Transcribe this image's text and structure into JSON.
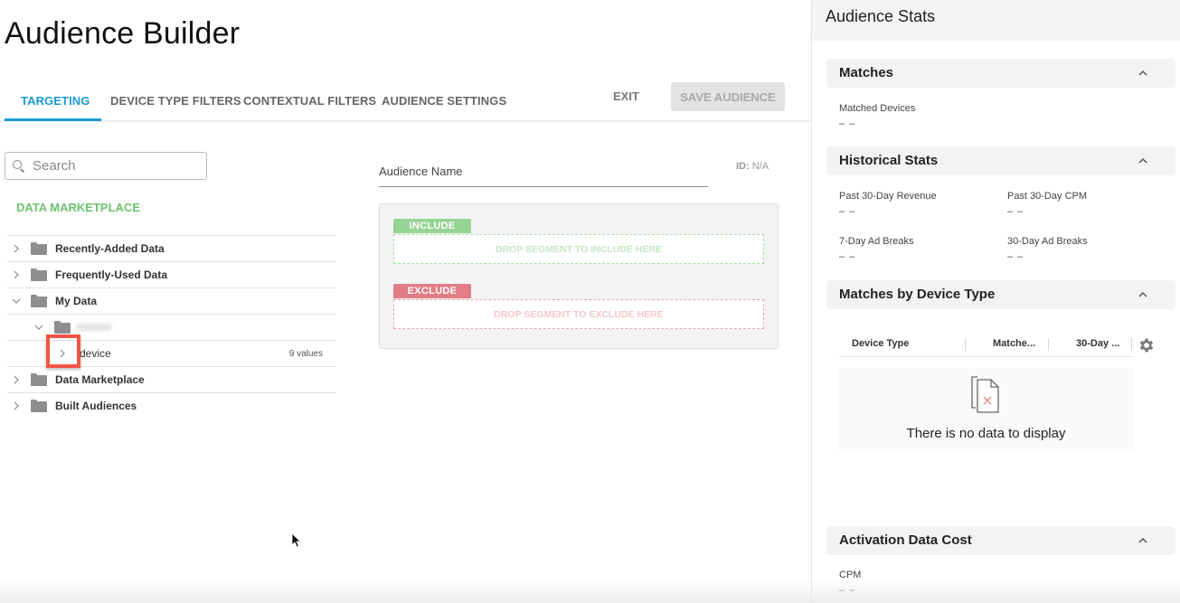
{
  "page": {
    "title": "Audience Builder"
  },
  "tabs": [
    {
      "label": "TARGETING",
      "active": true
    },
    {
      "label": "DEVICE TYPE FILTERS",
      "active": false
    },
    {
      "label": "CONTEXTUAL FILTERS",
      "active": false
    },
    {
      "label": "AUDIENCE SETTINGS",
      "active": false
    }
  ],
  "actions": {
    "exit_label": "EXIT",
    "save_label": "SAVE AUDIENCE"
  },
  "search": {
    "placeholder": "Search",
    "value": ""
  },
  "data_marketplace_heading": "DATA MARKETPLACE",
  "tree": {
    "items": [
      {
        "label": "Recently-Added Data",
        "expanded": false,
        "level": 0
      },
      {
        "label": "Frequently-Used Data",
        "expanded": false,
        "level": 0
      },
      {
        "label": "My Data",
        "expanded": true,
        "level": 0
      },
      {
        "label": "",
        "expanded": true,
        "level": 1,
        "redacted": true
      },
      {
        "label": "device",
        "expanded": false,
        "level": 2,
        "count": "9 values"
      },
      {
        "label": "Data Marketplace",
        "expanded": false,
        "level": 0
      },
      {
        "label": "Built Audiences",
        "expanded": false,
        "level": 0
      }
    ]
  },
  "audience": {
    "name_placeholder": "Audience Name",
    "id_label": "ID:",
    "id_value": "N/A"
  },
  "segments": {
    "include_tag": "INCLUDE",
    "include_drop": "DROP SEGMENT TO INCLUDE HERE",
    "exclude_tag": "EXCLUDE",
    "exclude_drop": "DROP SEGMENT TO EXCLUDE HERE"
  },
  "stats": {
    "title": "Audience Stats",
    "matches": {
      "title": "Matches",
      "matched_devices_label": "Matched Devices",
      "matched_devices_value": "– –"
    },
    "historical": {
      "title": "Historical Stats",
      "revenue_label": "Past 30-Day Revenue",
      "revenue_value": "– –",
      "cpm_label": "Past 30-Day CPM",
      "cpm_value": "– –",
      "ad7_label": "7-Day Ad Breaks",
      "ad7_value": "– –",
      "ad30_label": "30-Day Ad Breaks",
      "ad30_value": "– –"
    },
    "device_type": {
      "title": "Matches by Device Type",
      "columns": [
        "Device Type",
        "Matche...",
        "30-Day ..."
      ],
      "empty_text": "There is no data to display"
    },
    "activation": {
      "title": "Activation Data Cost",
      "cpm_label": "CPM",
      "cpm_value": "– –"
    }
  },
  "colors": {
    "accent": "#1a9bd7",
    "marketplace_green": "#6cc26c",
    "include_green": "#96d494",
    "exclude_red": "#e27c87",
    "highlight": "#f05545"
  }
}
